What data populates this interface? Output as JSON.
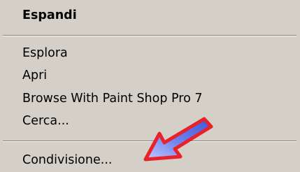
{
  "menu": {
    "default_item": "Espandi",
    "items": [
      "Esplora",
      "Apri",
      "Browse With Paint Shop Pro 7",
      "Cerca...",
      "Condivisione..."
    ]
  },
  "annotation": {
    "icon": "red-blue-arrow-pointer",
    "colors": {
      "outline": "#e8222a",
      "fill": "#7f8fe8"
    }
  },
  "colors": {
    "menu_background": "#d4d0c8",
    "separator_dark": "#808080",
    "separator_light": "#ffffff",
    "text": "#000000"
  }
}
